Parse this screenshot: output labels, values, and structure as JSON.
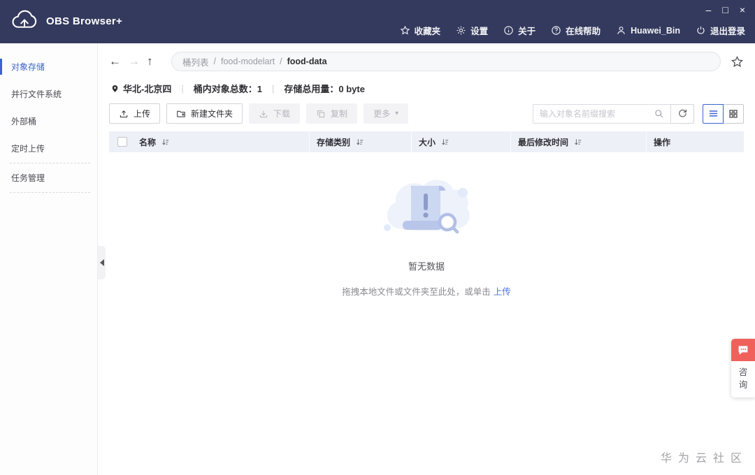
{
  "titlebar": {
    "app_title": "OBS Browser+",
    "menu": [
      {
        "label": "收藏夹",
        "icon": "star-icon"
      },
      {
        "label": "设置",
        "icon": "gear-icon"
      },
      {
        "label": "关于",
        "icon": "info-icon"
      },
      {
        "label": "在线帮助",
        "icon": "help-icon"
      },
      {
        "label": "Huawei_Bin",
        "icon": "user-icon"
      },
      {
        "label": "退出登录",
        "icon": "power-icon"
      }
    ],
    "window_controls": {
      "minimize": "–",
      "maximize": "□",
      "close": "×"
    }
  },
  "sidebar": {
    "items": [
      {
        "label": "对象存储",
        "active": true
      },
      {
        "label": "并行文件系统",
        "active": false
      },
      {
        "label": "外部桶",
        "active": false
      },
      {
        "label": "定时上传",
        "active": false
      },
      {
        "label": "任务管理",
        "active": false
      }
    ]
  },
  "navigation": {
    "back_icon": "←",
    "forward_icon": "→",
    "up_icon": "↑",
    "breadcrumb": {
      "root": "桶列表",
      "separator1": "/",
      "bucket": "food-modelart",
      "separator2": "/",
      "current": "food-data"
    }
  },
  "bucket_info": {
    "region": "华北-北京四",
    "divider1": "|",
    "object_count": "桶内对象总数：1",
    "divider2": "|",
    "storage_usage": "存储总用量：0 byte"
  },
  "toolbar": {
    "upload": "上传",
    "new_folder": "新建文件夹",
    "download": "下载",
    "copy": "复制",
    "more": "更多",
    "more_caret": "▾",
    "search_placeholder": "输入对象名前缀搜索"
  },
  "table": {
    "columns": [
      "名称",
      "存储类别",
      "大小",
      "最后修改时间",
      "操作"
    ],
    "rows": []
  },
  "empty_state": {
    "title": "暂无数据",
    "hint_text": "拖拽本地文件或文件夹至此处，或单击",
    "hint_link": "上传"
  },
  "consult": {
    "label": "咨询"
  },
  "watermark": "华为云社区",
  "colors": {
    "topbar_bg": "#343a5e",
    "accent_blue": "#3c64d0",
    "table_header_bg": "#eef0f8",
    "consult_red": "#f0615c",
    "link_blue": "#4a74e0"
  }
}
